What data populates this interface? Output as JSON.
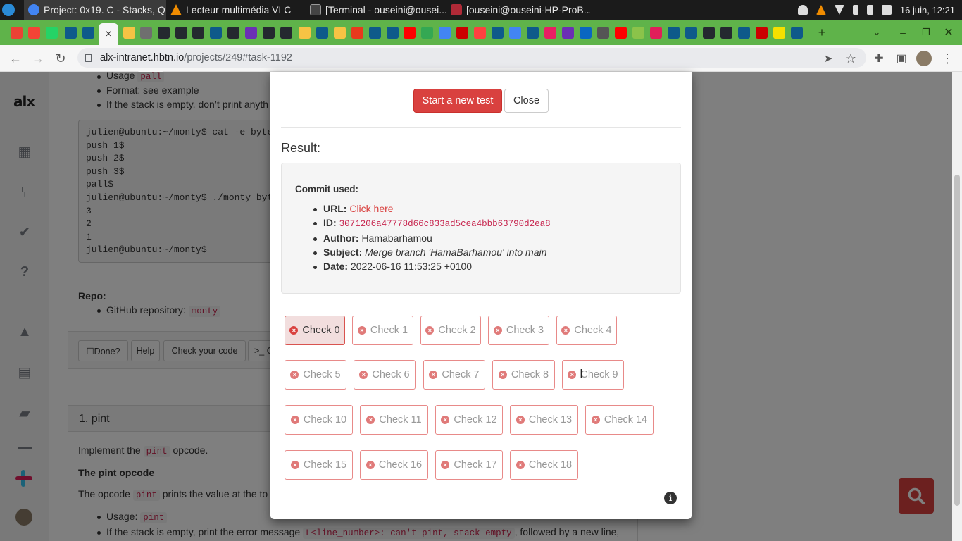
{
  "taskbar": {
    "apps": [
      {
        "label": "Project: 0x19. C - Stacks, Q...",
        "active": true
      },
      {
        "label": "Lecteur multimédia VLC",
        "active": false
      },
      {
        "label": "[Terminal - ouseini@ousei...",
        "active": false
      },
      {
        "label": "[ouseini@ouseini-HP-ProB...",
        "active": false
      }
    ],
    "clock": "16 juin, 12:21"
  },
  "browser": {
    "active_tab_close": "×",
    "new_tab": "+",
    "url_host": "alx-intranet.hbtn.io",
    "url_path": "/projects/249#task-1192",
    "favicon_colors": [
      "#ea4335",
      "#f44336",
      "#25d366",
      "#0e5a8a",
      "#0e5a8a",
      "#f6c344",
      "#6f6f6f",
      "#24292f",
      "#24292f",
      "#24292f",
      "#0e5a8a",
      "#24292f",
      "#6b2fb5",
      "#24292f",
      "#24292f",
      "#f6c344",
      "#0e5a8a",
      "#f6c344",
      "#e8391d",
      "#0e5a8a",
      "#0e5a8a",
      "#ff0000",
      "#34a853",
      "#4285f4",
      "#cc0000",
      "#ff4040",
      "#0e5a8a",
      "#4285f4",
      "#0e5a8a",
      "#e91e63",
      "#6b2fb5",
      "#0a66c2",
      "#555555",
      "#ff0000",
      "#8bc34a",
      "#e01e5a",
      "#0e5a8a",
      "#0e5a8a",
      "#24292f",
      "#24292f",
      "#0e5a8a",
      "#cc0000",
      "#f6e000",
      "#0e5a8a",
      "#24292f"
    ]
  },
  "background_page": {
    "usage_label": "Usage",
    "usage_code": "pall",
    "format_item": "Format: see example",
    "empty_item": "If the stack is empty, don’t print anyth",
    "pre_lines": [
      "julien@ubuntu:~/monty$ cat -e byte",
      "push 1$",
      "push 2$",
      "push 3$",
      "pall$",
      "julien@ubuntu:~/monty$ ./monty byt",
      "3",
      "2",
      "1",
      "julien@ubuntu:~/monty$"
    ],
    "repo_label": "Repo:",
    "repo_item": "GitHub repository:",
    "repo_code": "monty",
    "buttons": {
      "done": "☐Done?",
      "help": "Help",
      "check": "Check your code",
      "more": ">_ G"
    },
    "task_title": "1. pint",
    "impl_prefix": "Implement the",
    "impl_code": "pint",
    "impl_suffix": "opcode.",
    "pint_heading": "The pint opcode",
    "opcode_prefix": "The opcode",
    "opcode_code": "pint",
    "opcode_suffix": "prints the value at the to",
    "usage2_label": "Usage:",
    "usage2_code": "pint",
    "error_prefix": "If the stack is empty, print the error message",
    "error_code": "L<line_number>: can't pint, stack empty",
    "error_suffix": ", followed by a new line,"
  },
  "modal": {
    "start_button": "Start a new test",
    "close_button": "Close",
    "result_title": "Result:",
    "commit_used": "Commit used:",
    "url_label": "URL:",
    "url_link": "Click here",
    "id_label": "ID:",
    "id_value": "3071206a47778d66c833ad5cea4bbb63790d2ea8",
    "author_label": "Author:",
    "author_value": "Hamabarhamou",
    "subject_label": "Subject:",
    "subject_value": "Merge branch 'HamaBarhamou' into main",
    "date_label": "Date:",
    "date_value": "2022-06-16 11:53:25 +0100",
    "checks": [
      "Check 0",
      "Check 1",
      "Check 2",
      "Check 3",
      "Check 4",
      "Check 5",
      "Check 6",
      "Check 7",
      "Check 8",
      "Check 9",
      "Check 10",
      "Check 11",
      "Check 12",
      "Check 13",
      "Check 14",
      "Check 15",
      "Check 16",
      "Check 17",
      "Check 18"
    ]
  },
  "colors": {
    "accent": "#d9413f",
    "chrome_green": "#5fb34a",
    "taskbar": "#1b1b1b"
  }
}
